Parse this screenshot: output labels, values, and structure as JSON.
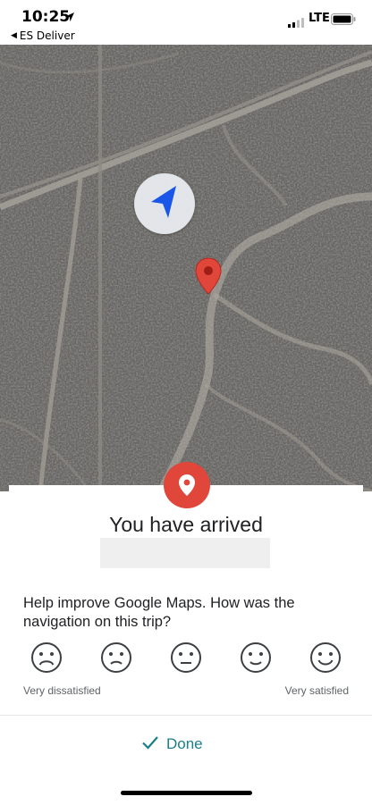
{
  "status_bar": {
    "time": "10:25",
    "back_app": "ES Deliver",
    "network": "LTE"
  },
  "icons": {
    "location_arrow": "location-arrow-icon",
    "signal": "signal-bars-icon",
    "battery": "battery-icon",
    "navigation": "navigation-arrow-icon",
    "destination": "map-pin-icon",
    "done": "checkmark-icon"
  },
  "colors": {
    "accent": "#1a7f8a",
    "pin_red": "#e0463a",
    "nav_blue": "#1a56e8"
  },
  "arrival_card": {
    "title": "You have arrived",
    "question": "Help improve Google Maps. How was the navigation on this trip?",
    "scale_low_label": "Very dissatisfied",
    "scale_high_label": "Very satisfied"
  },
  "bottom_bar": {
    "done_label": "Done"
  }
}
